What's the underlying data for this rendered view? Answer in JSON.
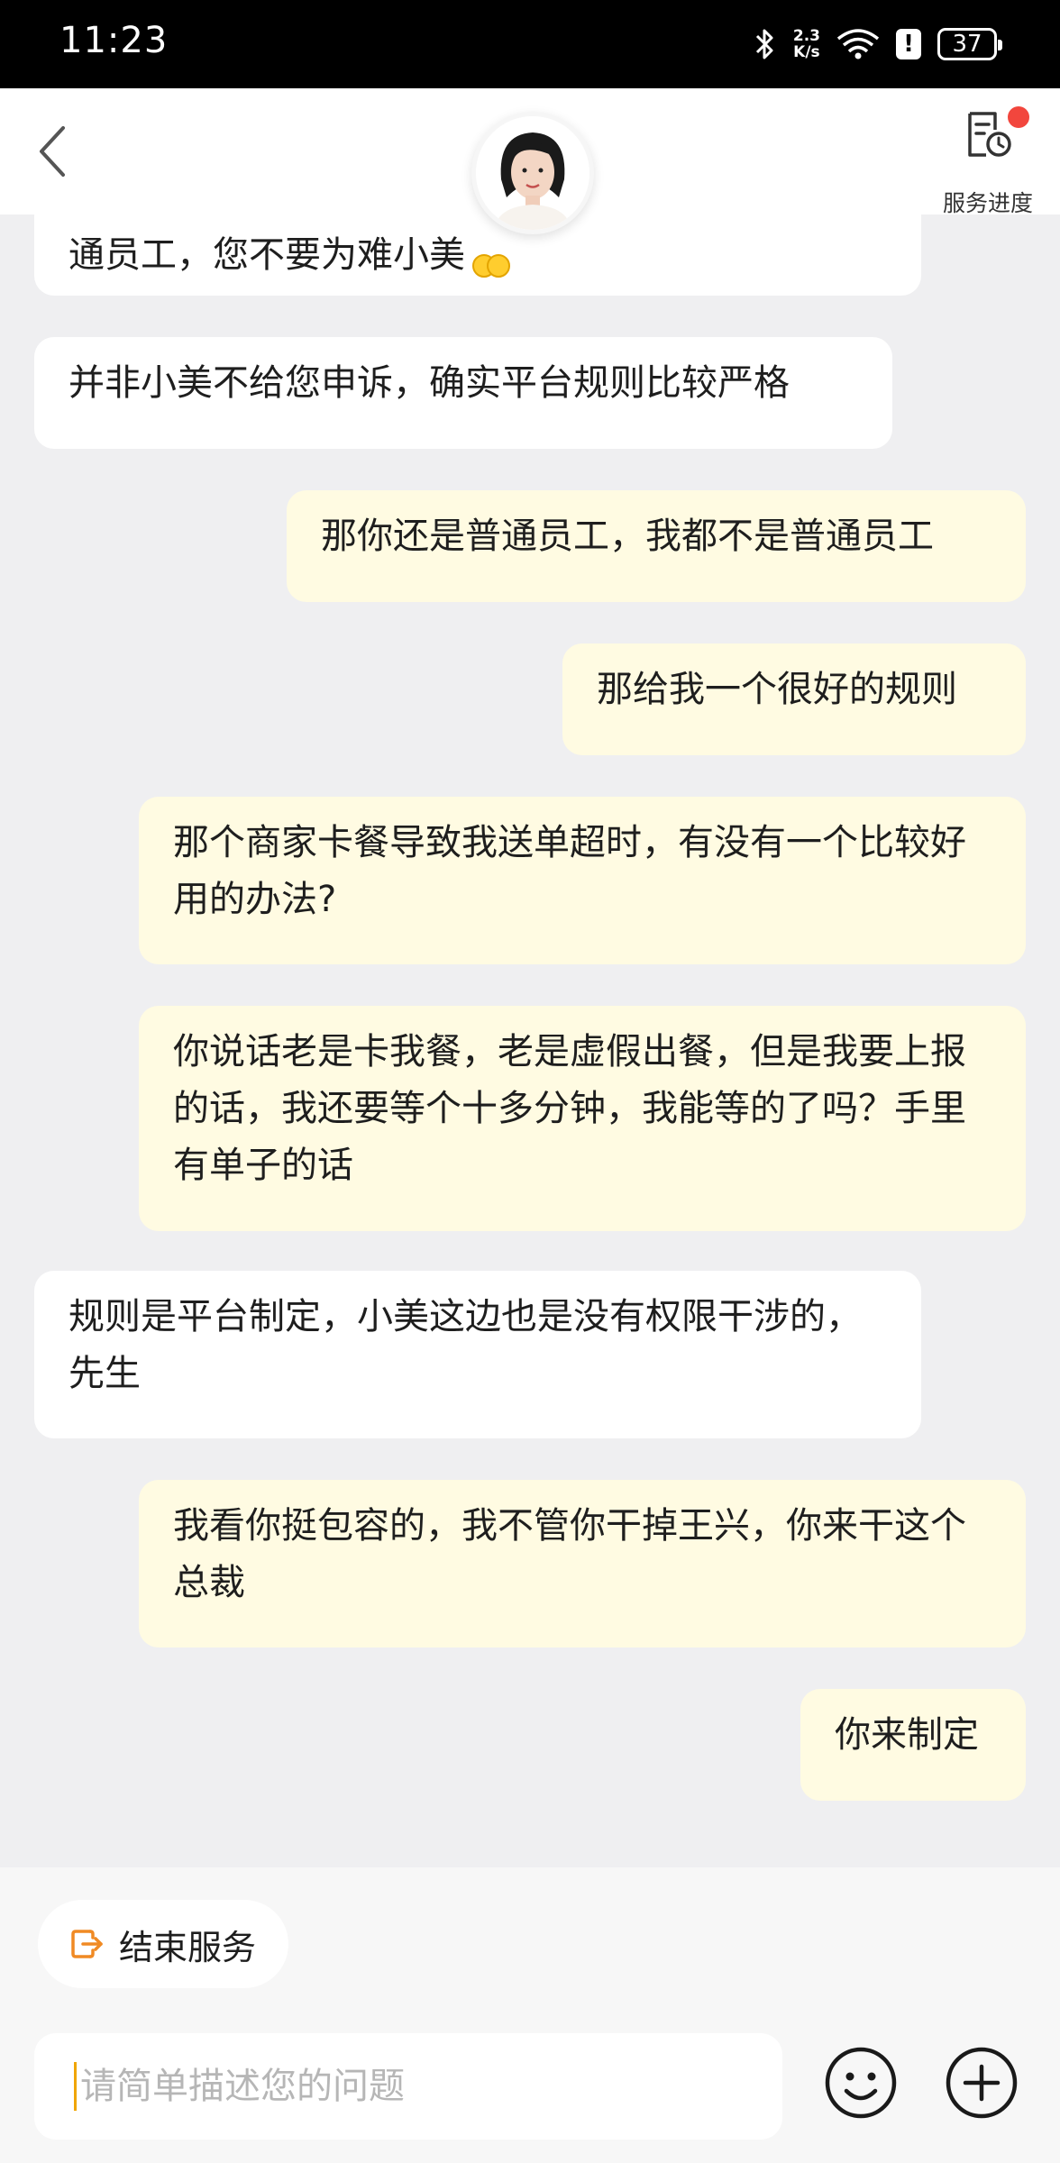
{
  "status_bar": {
    "time": "11:23",
    "net_speed_value": "2.3",
    "net_speed_unit": "K/s",
    "battery": "37"
  },
  "header": {
    "service_progress_label": "服务进度"
  },
  "messages": [
    {
      "side": "in",
      "text": "通员工，您不要为难小美"
    },
    {
      "side": "in",
      "text": "并非小美不给您申诉，确实平台规则比较严格"
    },
    {
      "side": "out",
      "text": "那你还是普通员工，我都不是普通员工"
    },
    {
      "side": "out",
      "text": "那给我一个很好的规则"
    },
    {
      "side": "out",
      "text": "那个商家卡餐导致我送单超时，有没有一个比较好用的办法?"
    },
    {
      "side": "out",
      "text": "你说话老是卡我餐，老是虚假出餐，但是我要上报的话，我还要等个十多分钟，我能等的了吗？手里有单子的话"
    },
    {
      "side": "in",
      "text": "规则是平台制定，小美这边也是没有权限干涉的，先生"
    },
    {
      "side": "out",
      "text": "我看你挺包容的，我不管你干掉王兴，你来干这个总裁"
    },
    {
      "side": "out",
      "text": "你来制定"
    }
  ],
  "bottom": {
    "end_service_label": "结束服务",
    "input_placeholder": "请简单描述您的问题"
  },
  "colors": {
    "incoming_bubble": "#ffffff",
    "outgoing_bubble": "#fffbe2",
    "background": "#efeff1",
    "accent_orange": "#f08a24",
    "notification_red": "#f2463d"
  },
  "icons": [
    "back-arrow-icon",
    "service-progress-icon",
    "exit-icon",
    "emoji-icon",
    "plus-icon",
    "bluetooth-icon",
    "wifi-icon"
  ]
}
